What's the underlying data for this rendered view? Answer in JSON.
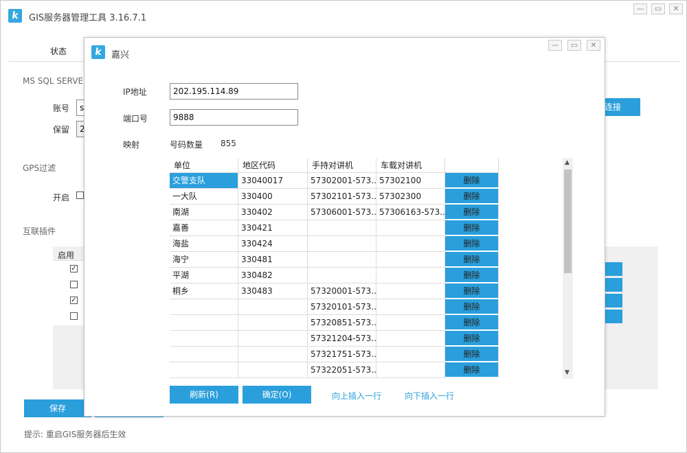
{
  "app": {
    "title": "GIS服务器管理工具 3.16.7.1",
    "tab": "状态"
  },
  "main": {
    "mssql_label": "MS SQL SERVER",
    "account_label": "账号",
    "account_value": "s",
    "keep_label": "保留",
    "keep_value": "2",
    "connect_button": "连接",
    "gps_label": "GPS过滤",
    "enable_label": "开启",
    "plugin_label": "互联插件",
    "plugin_enabled_header": "启用",
    "plugin_checks": [
      true,
      false,
      true,
      false
    ],
    "save_button": "保存",
    "hint": "提示:  重启GIS服务器后生效"
  },
  "dialog": {
    "title": "嘉兴",
    "ip_label": "IP地址",
    "ip_value": "202.195.114.89",
    "port_label": "端口号",
    "port_value": "9888",
    "mapping_label": "映射",
    "count_label": "号码数量",
    "count_value": "855",
    "columns": [
      "单位",
      "地区代码",
      "手持对讲机",
      "车载对讲机"
    ],
    "delete_label": "删除",
    "rows": [
      [
        "交警支队",
        "33040017",
        "57302001-573...",
        "57302100"
      ],
      [
        "一大队",
        "330400",
        "57302101-573...",
        "57302300"
      ],
      [
        "南湖",
        "330402",
        "57306001-573...",
        "57306163-573..."
      ],
      [
        "嘉善",
        "330421",
        "",
        ""
      ],
      [
        "海盐",
        "330424",
        "",
        ""
      ],
      [
        "海宁",
        "330481",
        "",
        ""
      ],
      [
        "平湖",
        "330482",
        "",
        ""
      ],
      [
        "桐乡",
        "330483",
        "57320001-573...",
        ""
      ],
      [
        "",
        "",
        "57320101-573...",
        ""
      ],
      [
        "",
        "",
        "57320851-573...",
        ""
      ],
      [
        "",
        "",
        "57321204-573...",
        ""
      ],
      [
        "",
        "",
        "57321751-573...",
        ""
      ],
      [
        "",
        "",
        "57322051-573...",
        ""
      ]
    ],
    "refresh_button": "刷新(R)",
    "ok_button": "确定(O)",
    "insert_above": "向上插入一行",
    "insert_below": "向下插入一行"
  },
  "icons": {
    "logo": "k-logo-icon",
    "minimize": "minimize-icon",
    "maximize": "maximize-icon",
    "close": "close-icon"
  }
}
